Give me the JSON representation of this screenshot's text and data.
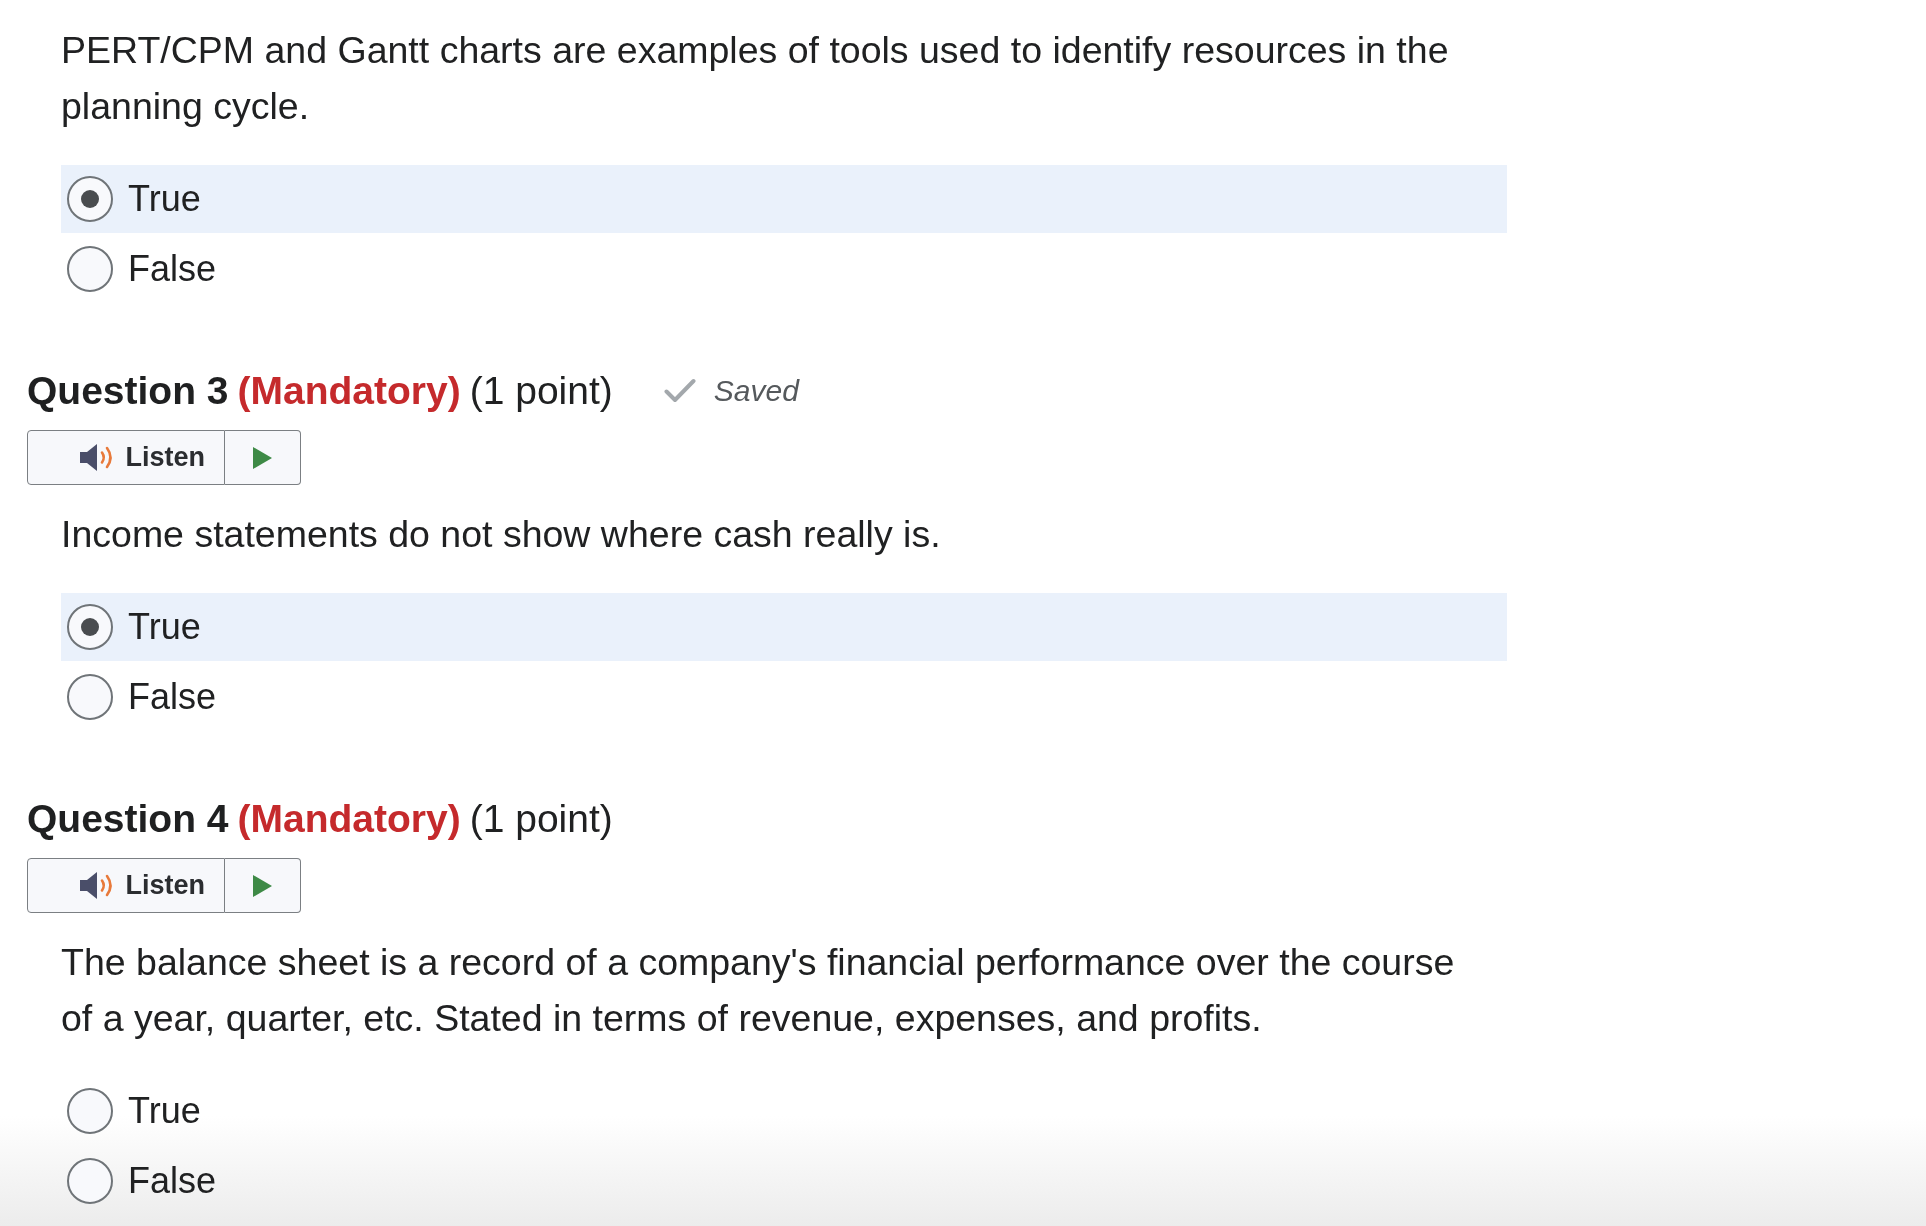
{
  "questions": [
    {
      "prompt": "PERT/CPM and Gantt charts are examples of tools used to identify resources in the planning cycle.",
      "options": [
        {
          "label": "True",
          "selected": true
        },
        {
          "label": "False",
          "selected": false
        }
      ]
    },
    {
      "title": "Question 3",
      "mandatory": "(Mandatory)",
      "points": "(1 point)",
      "status": "Saved",
      "listen": "Listen",
      "prompt": "Income statements do not show where cash really is.",
      "options": [
        {
          "label": "True",
          "selected": true
        },
        {
          "label": "False",
          "selected": false
        }
      ]
    },
    {
      "title": "Question 4",
      "mandatory": "(Mandatory)",
      "points": "(1 point)",
      "listen": "Listen",
      "prompt": "The balance sheet is a record of a company's financial performance over the course of a year, quarter, etc. Stated in terms of revenue, expenses, and profits.",
      "options": [
        {
          "label": "True",
          "selected": false
        },
        {
          "label": "False",
          "selected": false
        }
      ]
    }
  ]
}
